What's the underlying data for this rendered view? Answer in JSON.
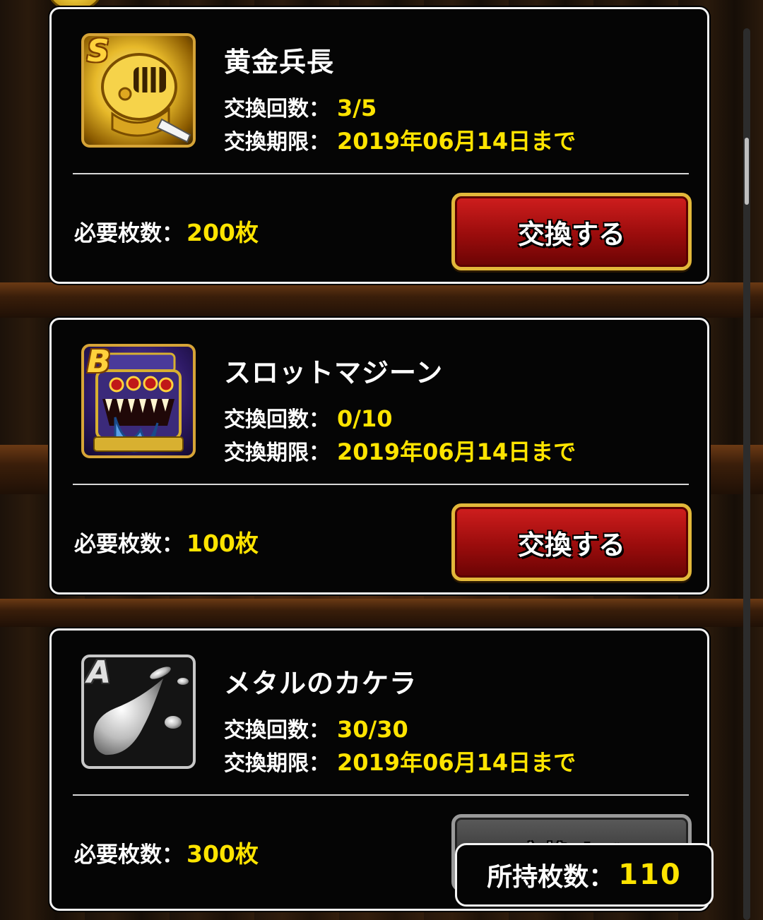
{
  "items": [
    {
      "rank": "S",
      "name": "黄金兵長",
      "count_label": "交換回数：",
      "count_value": "3/5",
      "deadline_label": "交換期限：",
      "deadline_value": "2019年06月14日まで",
      "required_label": "必要枚数：",
      "required_value": "200枚",
      "button_label": "交換する",
      "icon": "golden-knight-helmet-icon",
      "enabled": true
    },
    {
      "rank": "B",
      "name": "スロットマジーン",
      "count_label": "交換回数：",
      "count_value": "0/10",
      "deadline_label": "交換期限：",
      "deadline_value": "2019年06月14日まで",
      "required_label": "必要枚数：",
      "required_value": "100枚",
      "button_label": "交換する",
      "icon": "slot-machine-monster-icon",
      "enabled": true
    },
    {
      "rank": "A",
      "name": "メタルのカケラ",
      "count_label": "交換回数：",
      "count_value": "30/30",
      "deadline_label": "交換期限：",
      "deadline_value": "2019年06月14日まで",
      "required_label": "必要枚数：",
      "required_value": "300枚",
      "button_label": "交換する",
      "icon": "metal-fragment-icon",
      "enabled": false
    }
  ],
  "owned": {
    "label": "所持枚数：",
    "value": "110"
  },
  "colors": {
    "accent_yellow": "#ffe400",
    "button_red": "#b41414",
    "button_gold_border": "#e2b83a",
    "panel_bg": "#050505",
    "panel_border": "#f4f4f4"
  }
}
